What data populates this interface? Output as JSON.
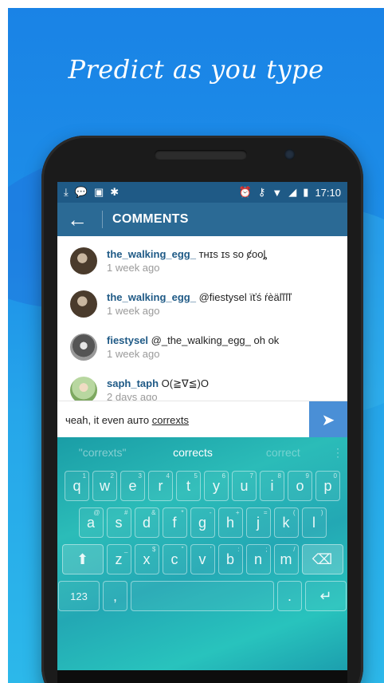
{
  "headline": "Predict as you type",
  "status": {
    "left_icons": [
      "download-icon",
      "chat-icon",
      "bag-icon",
      "android-icon"
    ],
    "right_icons": [
      "alarm-icon",
      "key-icon",
      "wifi-icon",
      "signal-icon",
      "battery-icon"
    ],
    "time": "17:10"
  },
  "appbar": {
    "back": "←",
    "title": "COMMENTS"
  },
  "comments": [
    {
      "user": "the_walking_egg_",
      "text": " ᴛʜɪs ɪs sᴏ ȼᴏᴏȴ",
      "time": "1 week ago"
    },
    {
      "user": "the_walking_egg_",
      "text": " @fiestysel ïťś ŕèäľľľľ",
      "time": "1 week ago"
    },
    {
      "user": "fiestysel",
      "text": " @_the_walking_egg_ oh ok",
      "time": "1 week ago"
    },
    {
      "user": "saph_taph",
      "text": " O(≧∇≦)O",
      "time": "2 days ago"
    }
  ],
  "input": {
    "text_prefix": "чeah, it even auто ",
    "text_word": "correxts",
    "send": "➤"
  },
  "suggestions": {
    "s1": "\"correxts\"",
    "s2": "corrects",
    "s3": "correct",
    "more": "⋮"
  },
  "keys": {
    "row1": [
      {
        "k": "q",
        "h": "1"
      },
      {
        "k": "w",
        "h": "2"
      },
      {
        "k": "e",
        "h": "3"
      },
      {
        "k": "r",
        "h": "4"
      },
      {
        "k": "t",
        "h": "5"
      },
      {
        "k": "y",
        "h": "6"
      },
      {
        "k": "u",
        "h": "7"
      },
      {
        "k": "i",
        "h": "8"
      },
      {
        "k": "o",
        "h": "9"
      },
      {
        "k": "p",
        "h": "0"
      }
    ],
    "row2": [
      {
        "k": "a",
        "h": "@"
      },
      {
        "k": "s",
        "h": "#"
      },
      {
        "k": "d",
        "h": "&"
      },
      {
        "k": "f",
        "h": "*"
      },
      {
        "k": "g",
        "h": "-"
      },
      {
        "k": "h",
        "h": "+"
      },
      {
        "k": "j",
        "h": "="
      },
      {
        "k": "k",
        "h": "("
      },
      {
        "k": "l",
        "h": ")"
      }
    ],
    "row3": [
      {
        "k": "z",
        "h": "_"
      },
      {
        "k": "x",
        "h": "$"
      },
      {
        "k": "c",
        "h": "\""
      },
      {
        "k": "v",
        "h": "'"
      },
      {
        "k": "b",
        "h": ":"
      },
      {
        "k": "n",
        "h": ";"
      },
      {
        "k": "m",
        "h": "/"
      }
    ],
    "shift": "⬆",
    "del": "⌫",
    "num": "123",
    "comma": ",",
    "period": ".",
    "enter": "↵"
  },
  "navbar": {
    "back": "▽",
    "home": "○",
    "recents": "□",
    "keyboard": "⌨"
  }
}
